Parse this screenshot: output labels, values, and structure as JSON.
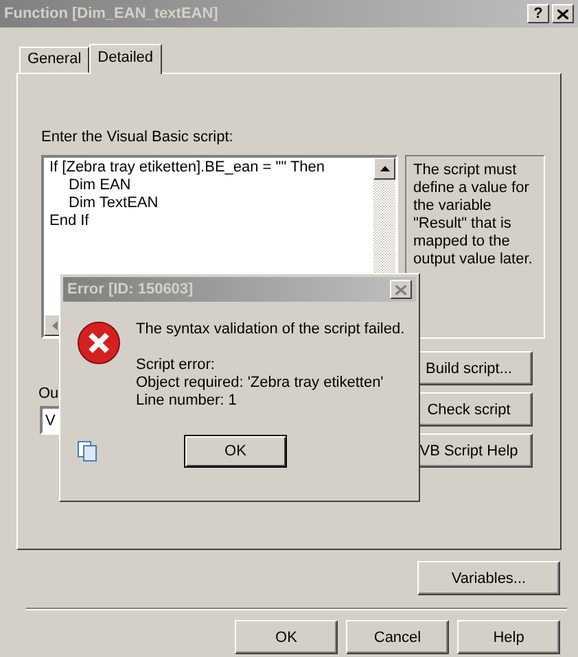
{
  "window": {
    "title": "Function [Dim_EAN_textEAN]",
    "help_button": "?"
  },
  "tabs": [
    {
      "label": "General",
      "selected": false
    },
    {
      "label": "Detailed",
      "selected": true
    }
  ],
  "script_label": "Enter the Visual Basic script:",
  "script_lines": [
    {
      "text": "If [Zebra tray etiketten].BE_ean = \"\" Then",
      "indented": false
    },
    {
      "text": "Dim EAN",
      "indented": true
    },
    {
      "text": "Dim TextEAN",
      "indented": true
    },
    {
      "text": "End If",
      "indented": false
    }
  ],
  "hint": "The script must define a value for the variable \"Result\" that is mapped to the output value later.",
  "side_buttons": [
    "Build script...",
    "Check script",
    "VB Script Help"
  ],
  "output_label": "Ou",
  "output_value": "V",
  "variables_button": "Variables...",
  "footer_buttons": [
    "OK",
    "Cancel",
    "Help"
  ],
  "error_dialog": {
    "title": "Error [ID: 150603]",
    "message": "The syntax validation of the script failed.",
    "details": [
      "Script error:",
      "Object required: 'Zebra tray etiketten'",
      "Line number: 1"
    ],
    "ok_button": "OK"
  }
}
